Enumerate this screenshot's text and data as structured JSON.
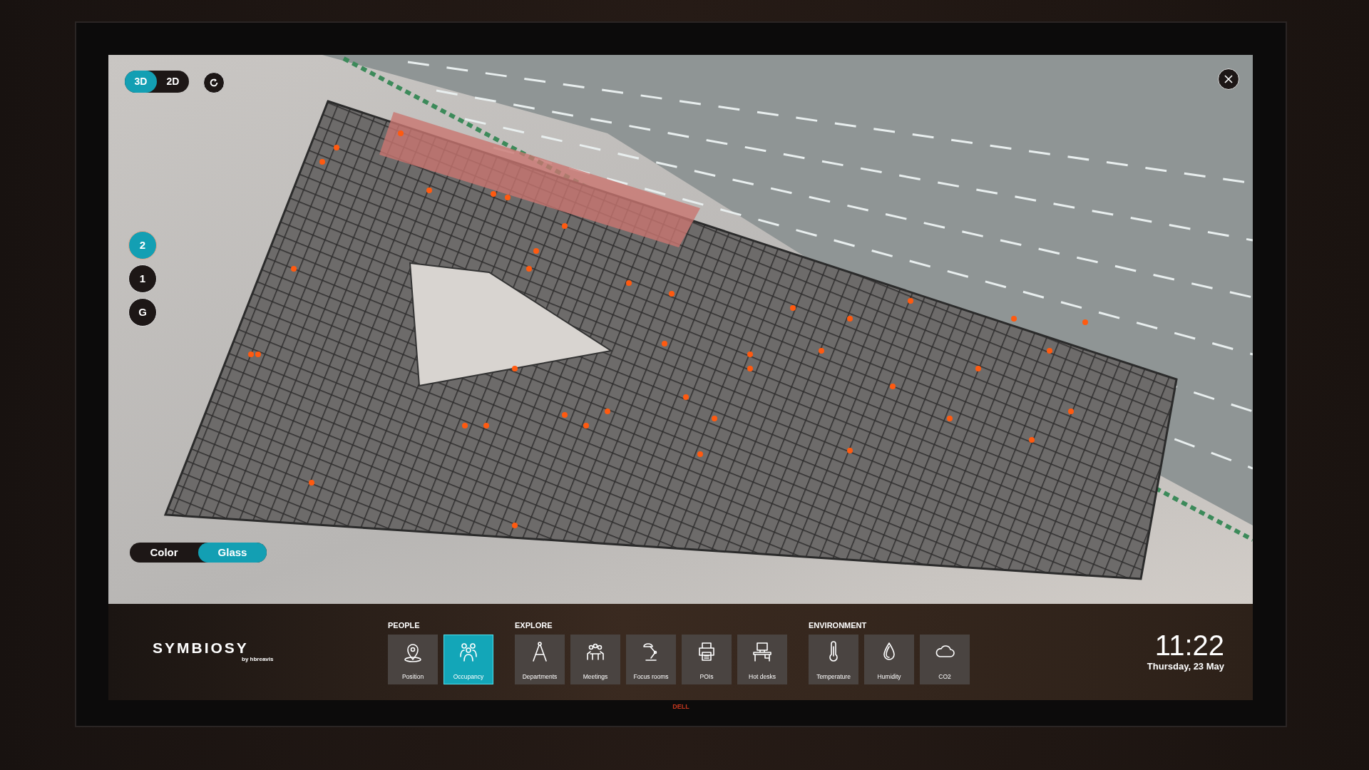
{
  "view_toggle": [
    {
      "label": "3D",
      "selected": true
    },
    {
      "label": "2D",
      "selected": false
    }
  ],
  "floors": [
    {
      "label": "2",
      "selected": true
    },
    {
      "label": "1",
      "selected": false
    },
    {
      "label": "G",
      "selected": false
    }
  ],
  "style_toggle": [
    {
      "label": "Color",
      "selected": false
    },
    {
      "label": "Glass",
      "selected": true
    }
  ],
  "brand": {
    "name": "SYMBIOSY",
    "byline": "by hbreavis"
  },
  "groups": [
    {
      "title": "PEOPLE",
      "items": [
        {
          "label": "Position",
          "kind": "pin",
          "selected": false
        },
        {
          "label": "Occupancy",
          "kind": "people",
          "selected": true
        }
      ]
    },
    {
      "title": "EXPLORE",
      "items": [
        {
          "label": "Departments",
          "kind": "compass",
          "selected": false
        },
        {
          "label": "Meetings",
          "kind": "meeting",
          "selected": false
        },
        {
          "label": "Focus rooms",
          "kind": "lamp",
          "selected": false
        },
        {
          "label": "POIs",
          "kind": "printer",
          "selected": false
        },
        {
          "label": "Hot desks",
          "kind": "desk",
          "selected": false
        }
      ]
    },
    {
      "title": "ENVIRONMENT",
      "items": [
        {
          "label": "Temperature",
          "kind": "thermometer",
          "selected": false
        },
        {
          "label": "Humidity",
          "kind": "drop",
          "selected": false
        },
        {
          "label": "CO2",
          "kind": "cloud",
          "selected": false
        }
      ]
    }
  ],
  "clock": {
    "time": "11:22",
    "date": "Thursday, 23 May"
  },
  "monitor": {
    "logo": "DELL"
  }
}
